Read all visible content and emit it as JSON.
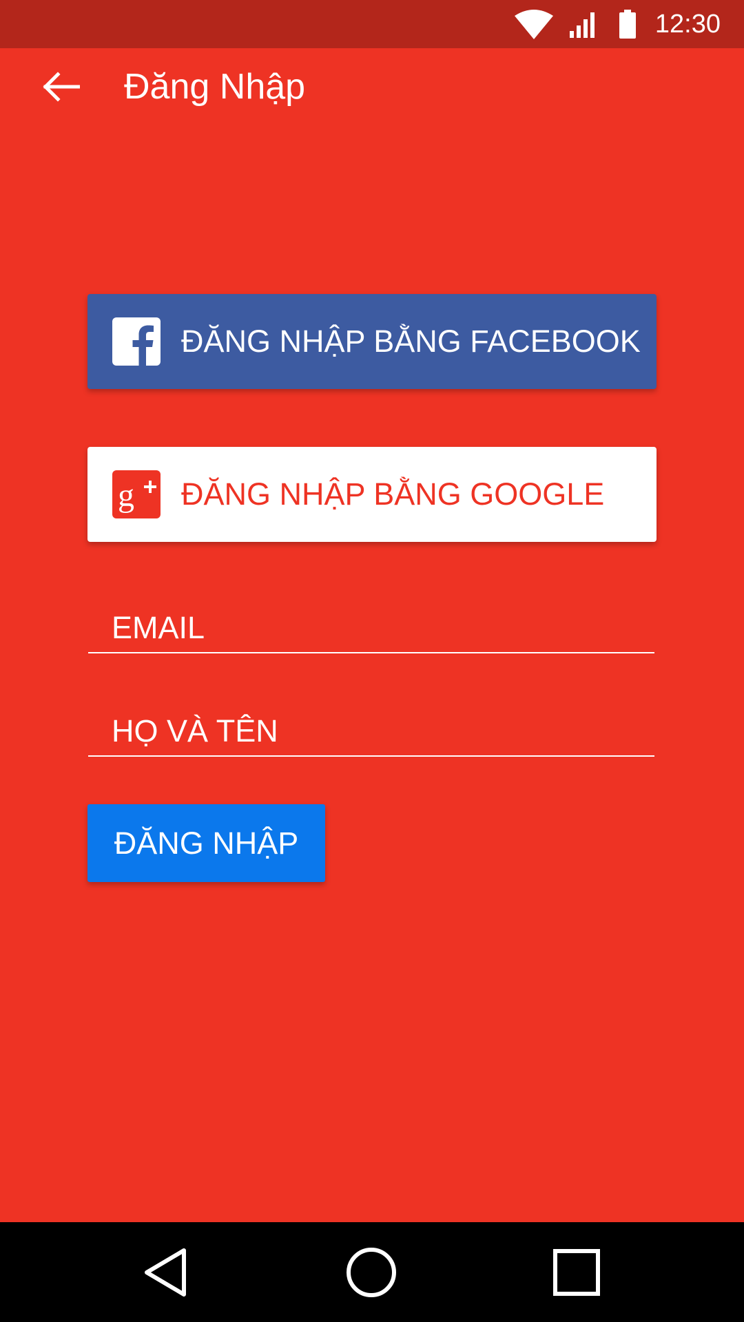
{
  "status_bar": {
    "time": "12:30",
    "icons": [
      "wifi-icon",
      "signal-icon",
      "battery-icon"
    ],
    "background": "#b3261b"
  },
  "app_bar": {
    "title": "Đăng Nhập",
    "back_icon": "arrow-left-icon"
  },
  "social_login": {
    "facebook_label": "ĐĂNG NHẬP BẰNG FACEBOOK",
    "facebook_color": "#3d5ba1",
    "facebook_icon": "facebook-icon",
    "google_label": "ĐĂNG NHẬP BẰNG GOOGLE",
    "google_color": "#ffffff",
    "google_icon": "google-plus-icon"
  },
  "form": {
    "email_placeholder": "EMAIL",
    "email_value": "",
    "name_placeholder": "HỌ VÀ TÊN",
    "name_value": "",
    "submit_label": "ĐĂNG NHẬP",
    "submit_color": "#0b78ec"
  },
  "nav_bar": {
    "icons": [
      "nav-back-icon",
      "nav-home-icon",
      "nav-recents-icon"
    ]
  },
  "theme": {
    "primary": "#ee3324",
    "primary_dark": "#b3261b"
  }
}
